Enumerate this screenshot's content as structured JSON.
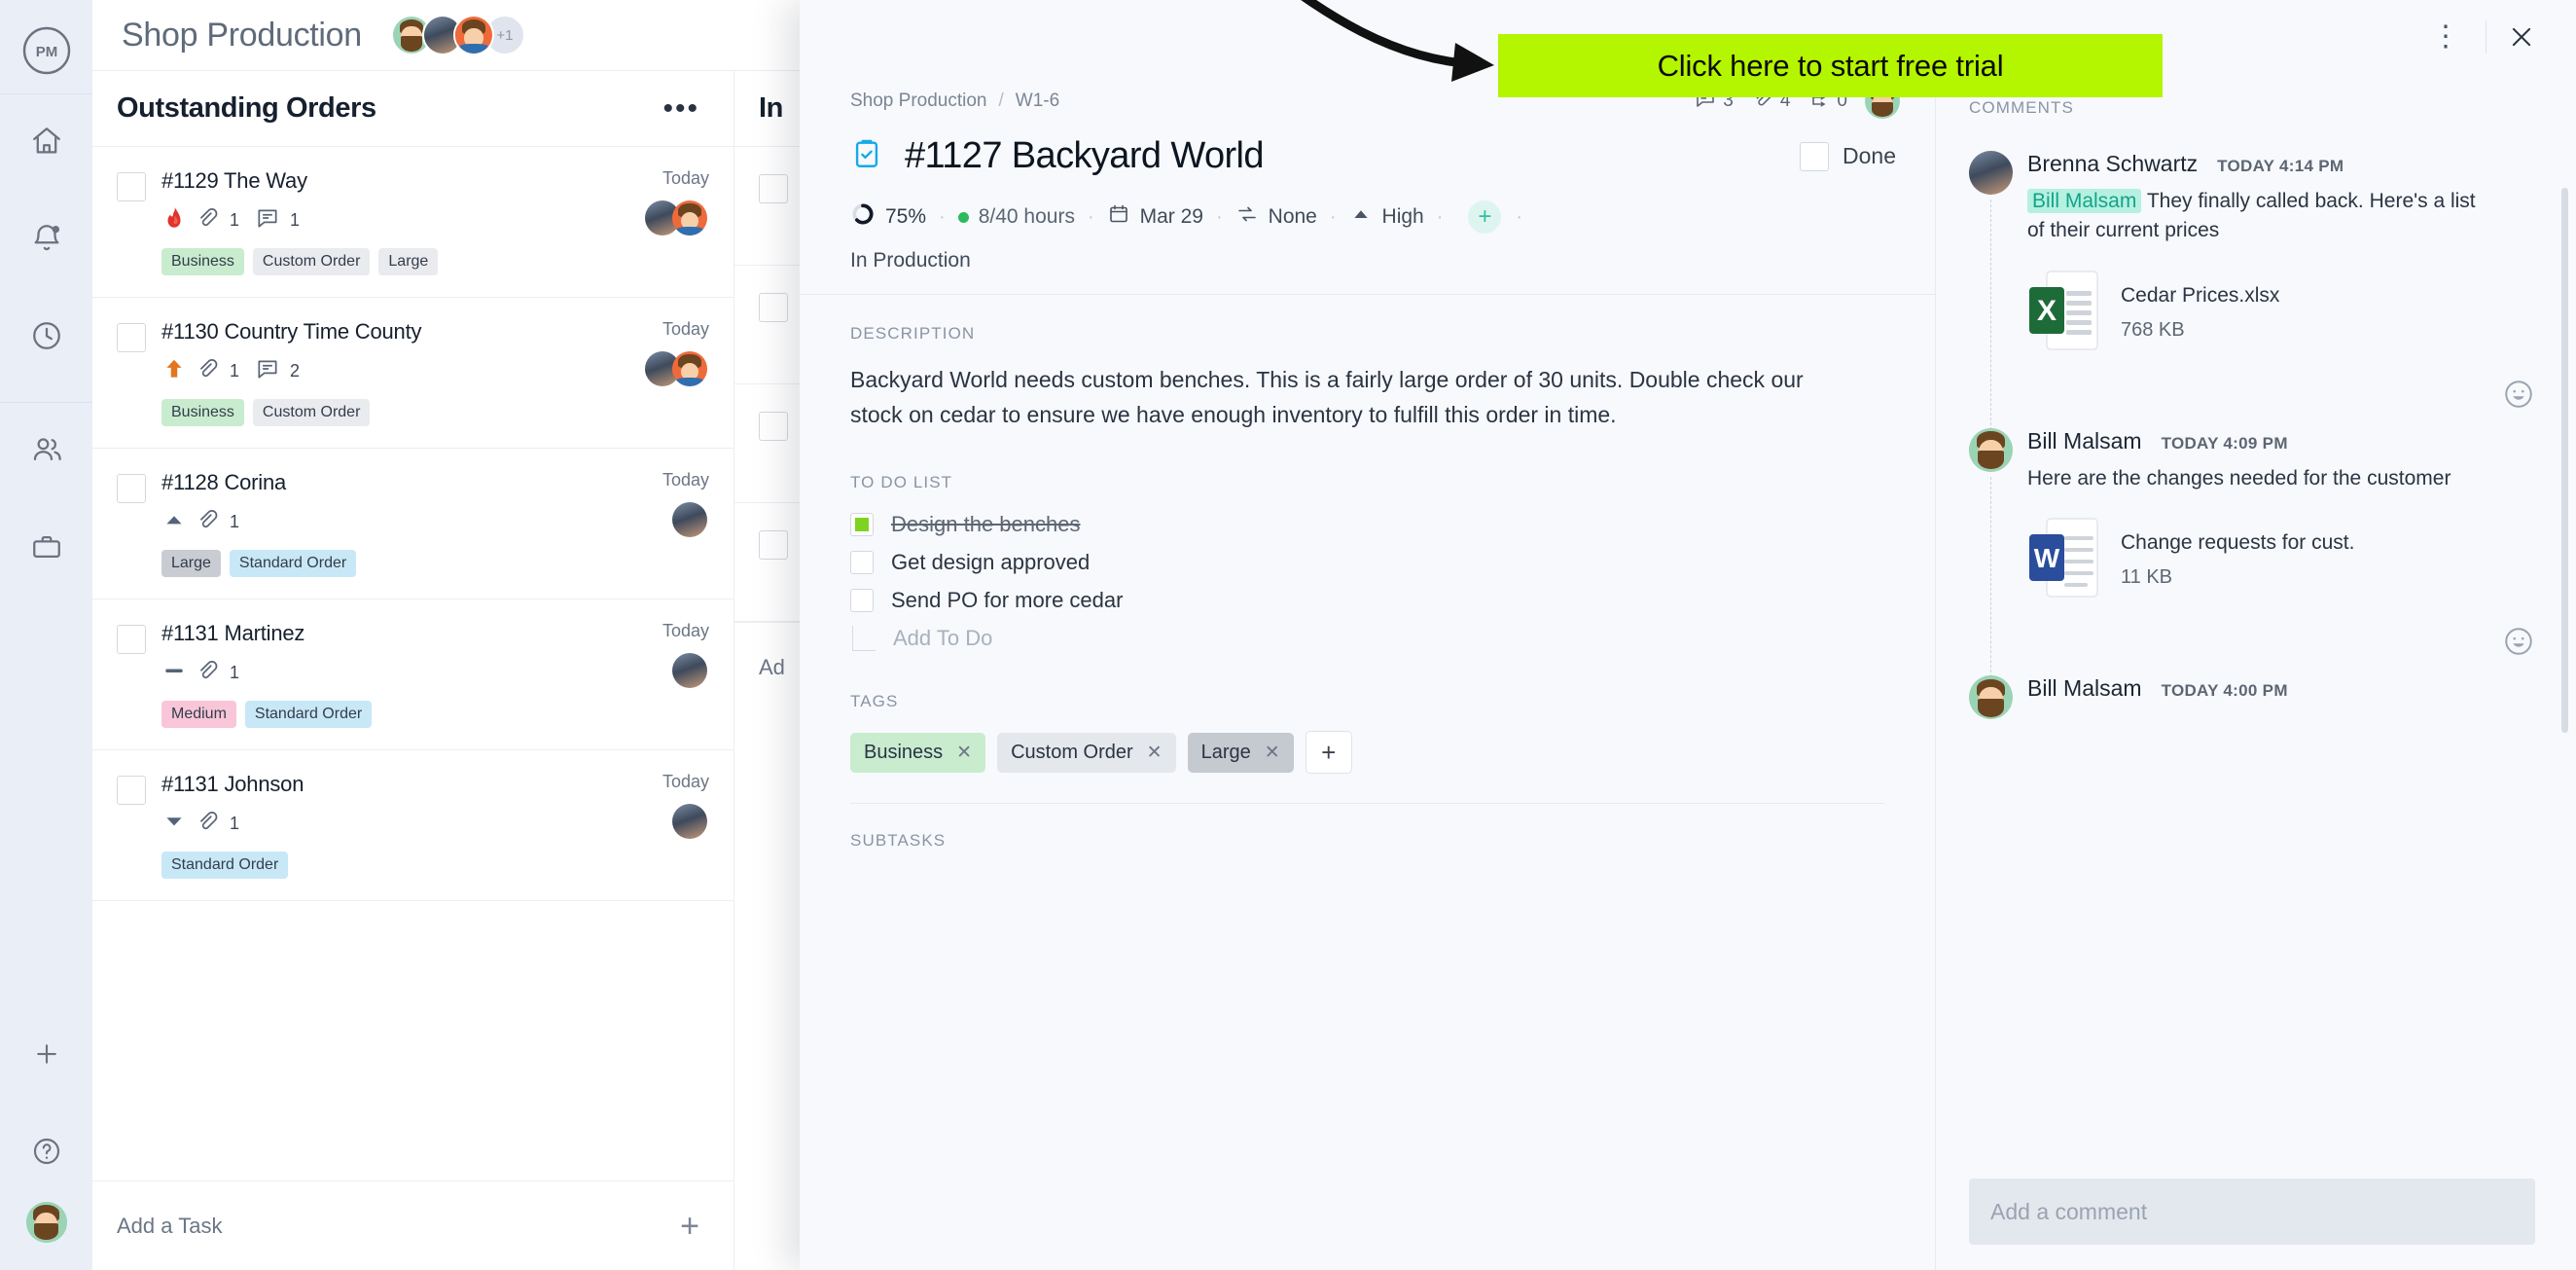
{
  "app": {
    "logo_text": "PM",
    "project_title": "Shop Production",
    "avatar_overflow": "+1"
  },
  "rail": {
    "items": [
      {
        "name": "home-icon",
        "label": "Home"
      },
      {
        "name": "notifications-icon",
        "label": "Notifications"
      },
      {
        "name": "time-icon",
        "label": "Time"
      },
      {
        "name": "people-icon",
        "label": "People"
      },
      {
        "name": "briefcase-icon",
        "label": "Projects"
      }
    ],
    "bottom": [
      {
        "name": "add-icon",
        "label": "Add"
      },
      {
        "name": "help-icon",
        "label": "Help"
      }
    ]
  },
  "board": {
    "columns": [
      {
        "title": "Outstanding Orders",
        "menu_label": "•••",
        "add_task_label": "Add a Task",
        "add_task_plus": "+",
        "tasks": [
          {
            "name": "#1129 The Way",
            "priority_icon": "fire-icon",
            "attachments": "1",
            "comments": "1",
            "date": "Today",
            "tags": [
              {
                "label": "Business",
                "color": "green"
              },
              {
                "label": "Custom Order",
                "color": "grey"
              },
              {
                "label": "Large",
                "color": "grey"
              }
            ]
          },
          {
            "name": "#1130 Country Time County",
            "priority_icon": "arrow-up-orange-icon",
            "attachments": "1",
            "comments": "2",
            "date": "Today",
            "tags": [
              {
                "label": "Business",
                "color": "green"
              },
              {
                "label": "Custom Order",
                "color": "grey"
              }
            ]
          },
          {
            "name": "#1128 Corina",
            "priority_icon": "triangle-up-icon",
            "attachments": "1",
            "comments": "",
            "date": "Today",
            "tags": [
              {
                "label": "Large",
                "color": "dgrey"
              },
              {
                "label": "Standard Order",
                "color": "blue"
              }
            ]
          },
          {
            "name": "#1131 Martinez",
            "priority_icon": "dash-icon",
            "attachments": "1",
            "comments": "",
            "date": "Today",
            "tags": [
              {
                "label": "Medium",
                "color": "pink"
              },
              {
                "label": "Standard Order",
                "color": "blue"
              }
            ]
          },
          {
            "name": "#1131 Johnson",
            "priority_icon": "triangle-down-icon",
            "attachments": "1",
            "comments": "",
            "date": "Today",
            "tags": [
              {
                "label": "Standard Order",
                "color": "blue"
              }
            ]
          }
        ]
      },
      {
        "title": "In",
        "add_task_label": "Ad"
      }
    ]
  },
  "cta": {
    "label": "Click here to start free trial",
    "bg_color": "#b4f500"
  },
  "modal": {
    "kebab_label": "⋮",
    "close_label": "✕",
    "breadcrumb": {
      "project": "Shop Production",
      "separator": "/",
      "sprint": "W1-6"
    },
    "stats": {
      "comments": "3",
      "attachments": "4",
      "subtasks": "0"
    },
    "title": "#1127 Backyard World",
    "done_label": "Done",
    "props": {
      "progress": "75%",
      "hours": "8/40 hours",
      "date": "Mar 29",
      "repeat": "None",
      "priority": "High",
      "assignee_add": "+"
    },
    "status": "In Production",
    "sections": {
      "description_label": "DESCRIPTION",
      "description_text": "Backyard World needs custom benches. This is a fairly large order of 30 units. Double check our stock on cedar to ensure we have enough inventory to fulfill this order in time.",
      "todo_label": "TO DO LIST",
      "todo_items": [
        {
          "text": "Design the benches",
          "done": true
        },
        {
          "text": "Get design approved",
          "done": false
        },
        {
          "text": "Send PO for more cedar",
          "done": false
        }
      ],
      "todo_add_label": "Add To Do",
      "tags_label": "TAGS",
      "tags": [
        {
          "label": "Business",
          "color": "green",
          "remove": "✕"
        },
        {
          "label": "Custom Order",
          "color": "grey",
          "remove": "✕"
        },
        {
          "label": "Large",
          "color": "dgrey",
          "remove": "✕"
        }
      ],
      "tag_add": "+",
      "subtasks_label": "SUBTASKS"
    }
  },
  "comments": {
    "header": "COMMENTS",
    "input_placeholder": "Add a comment",
    "items": [
      {
        "author": "Brenna Schwartz",
        "time": "TODAY 4:14 PM",
        "mention": "Bill Malsam",
        "text": "They finally called back. Here's a list of their current prices",
        "attachment": {
          "type": "xlsx",
          "badge": "X",
          "name": "Cedar Prices.xlsx",
          "size": "768 KB"
        }
      },
      {
        "author": "Bill Malsam",
        "time": "TODAY 4:09 PM",
        "mention": "",
        "text": "Here are the changes needed for the customer",
        "attachment": {
          "type": "docx",
          "badge": "W",
          "name": "Change requests for cust.",
          "size": "11 KB"
        }
      },
      {
        "author": "Bill Malsam",
        "time": "TODAY 4:00 PM",
        "mention": "",
        "text": "",
        "attachment": null
      }
    ]
  }
}
